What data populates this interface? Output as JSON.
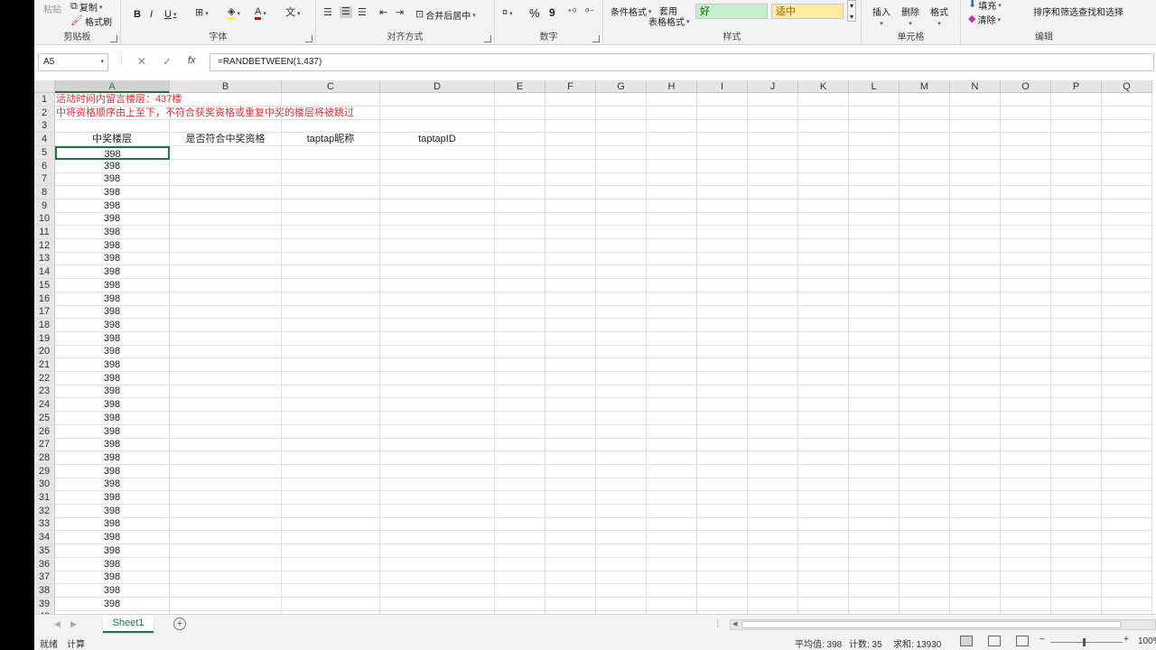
{
  "ribbon": {
    "clipboard": {
      "label": "剪贴板",
      "paste": "粘贴",
      "copy": "复制",
      "format_painter": "格式刷"
    },
    "font": {
      "label": "字体",
      "bold": "B",
      "italic": "I",
      "underline": "U"
    },
    "alignment": {
      "label": "对齐方式",
      "merge_center": "合并后居中"
    },
    "number": {
      "label": "数字",
      "percent": "%",
      "comma": "9"
    },
    "styles": {
      "label": "样式",
      "conditional": "条件格式",
      "table_format_1": "套用",
      "table_format_2": "表格格式",
      "good": "好",
      "neutral": "适中"
    },
    "cells": {
      "label": "单元格",
      "insert": "插入",
      "delete": "删除",
      "format": "格式"
    },
    "editing": {
      "label": "编辑",
      "fill": "填充",
      "clear": "清除",
      "sort_filter": "排序和筛选",
      "find_select": "查找和选择"
    }
  },
  "formula_bar": {
    "name_box": "A5",
    "fx": "fx",
    "formula": "=RANDBETWEEN(1,437)"
  },
  "columns": [
    "A",
    "B",
    "C",
    "D",
    "E",
    "F",
    "G",
    "H",
    "I",
    "J",
    "K",
    "L",
    "M",
    "N",
    "O",
    "P",
    "Q"
  ],
  "sheet": {
    "row1": "活动时间内留言楼层：437楼",
    "row2": "中将资格顺序由上至下，不符合获奖资格或重复中奖的楼层将被跳过",
    "headers": [
      "中奖楼层",
      "是否符合中奖资格",
      "taptap昵称",
      "taptapID"
    ],
    "value": "398"
  },
  "tabs": {
    "sheet1": "Sheet1",
    "add": "+"
  },
  "status": {
    "ready": "就绪",
    "calc": "计算",
    "average": "平均值: 398",
    "count": "计数: 35",
    "sum": "求和: 13930",
    "zoom": "100%"
  },
  "colors": {
    "accent": "#217346",
    "red_text": "#e8333b",
    "good_bg": "#c6efce",
    "good_fg": "#006100",
    "neutral_bg": "#ffeb9c",
    "neutral_fg": "#9c5700"
  }
}
